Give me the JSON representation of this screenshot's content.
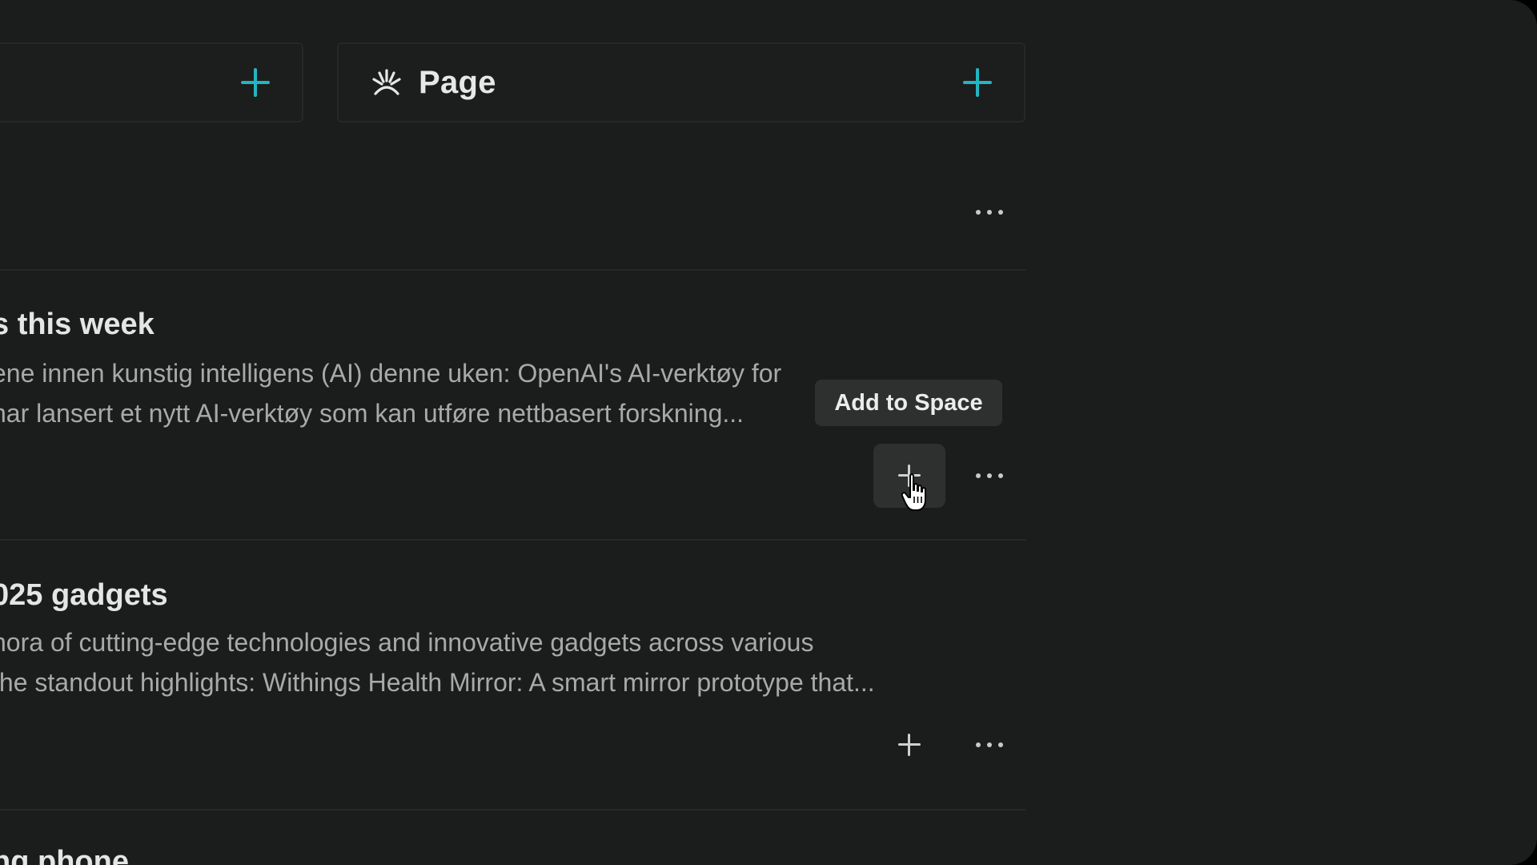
{
  "header": {
    "page_title": "Page"
  },
  "items": [
    {
      "title": "s this week",
      "line1": "ene innen kunstig intelligens (AI) denne uken: OpenAI's AI-verktøy for",
      "line2": "har lansert et nytt AI-verktøy som kan utføre nettbasert forskning..."
    },
    {
      "title": "025 gadgets",
      "line1": "hora of cutting-edge technologies and innovative gadgets across various",
      "line2": "the standout highlights: Withings Health Mirror: A smart mirror prototype that..."
    },
    {
      "title": "ng phone"
    }
  ],
  "tooltip": {
    "label": "Add to Space"
  },
  "icons": {
    "page": "page-sparkle-icon",
    "add": "plus-icon",
    "more": "more-horizontal-icon",
    "cursor": "hand-pointer-cursor"
  },
  "colors": {
    "accent": "#23b5c0",
    "background": "#1b1c1c",
    "text": "#e6e7e7",
    "muted": "#a8aaaa"
  }
}
